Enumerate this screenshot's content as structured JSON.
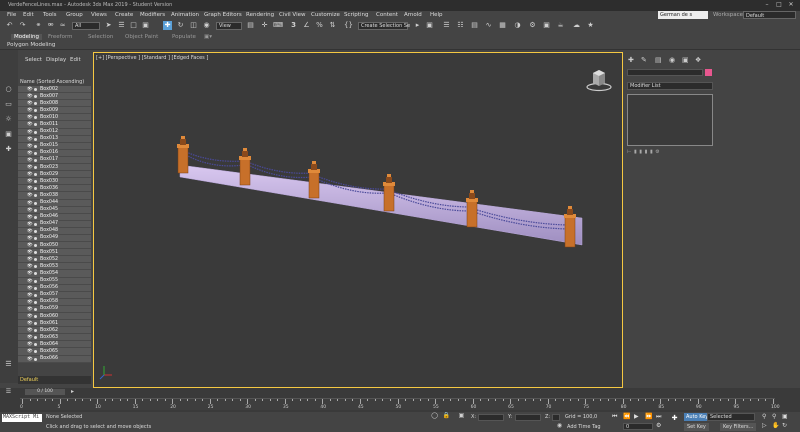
{
  "window": {
    "title": "VerdeFenceLines.max - Autodesk 3ds Max 2019 - Student Version",
    "user": "German de s",
    "workspace_label": "Workspaces:",
    "workspace_value": "Default"
  },
  "menu": [
    "File",
    "Edit",
    "Tools",
    "Group",
    "Views",
    "Create",
    "Modifiers",
    "Animation",
    "Graph Editors",
    "Rendering",
    "Civil View",
    "Customize",
    "Scripting",
    "Content",
    "Arnold",
    "Help"
  ],
  "toolbar": {
    "filter_value": "All",
    "view_value": "View",
    "selection_set": "Create Selection Se"
  },
  "ribbon": {
    "tabs": [
      "Modeling",
      "Freeform",
      "Selection",
      "Object Paint",
      "Populate"
    ],
    "active_tab": "Modeling",
    "sub": "Polygon Modeling"
  },
  "explorer": {
    "tabs": [
      "Select",
      "Display",
      "Edit"
    ],
    "header": "Name (Sorted Ascending)",
    "items": [
      "Box002",
      "Box007",
      "Box008",
      "Box009",
      "Box010",
      "Box011",
      "Box012",
      "Box013",
      "Box015",
      "Box016",
      "Box017",
      "Box023",
      "Box029",
      "Box030",
      "Box036",
      "Box038",
      "Box044",
      "Box045",
      "Box046",
      "Box047",
      "Box048",
      "Box049",
      "Box050",
      "Box051",
      "Box052",
      "Box053",
      "Box054",
      "Box055",
      "Box056",
      "Box057",
      "Box058",
      "Box059",
      "Box060",
      "Box061",
      "Box062",
      "Box063",
      "Box064",
      "Box065",
      "Box066"
    ],
    "layer": "Default"
  },
  "viewport": {
    "label": "[+] [Perspective ] [Standard ] [Edged Faces ]"
  },
  "command_panel": {
    "modifier_list": "Modifier List"
  },
  "timeline": {
    "slider": "0 / 100",
    "ticks": [
      "0",
      "5",
      "10",
      "15",
      "20",
      "25",
      "30",
      "35",
      "40",
      "45",
      "50",
      "55",
      "60",
      "65",
      "70",
      "75",
      "80",
      "85",
      "90",
      "95",
      "100"
    ]
  },
  "status": {
    "maxscript": "MAXScript Mi",
    "none_selected": "None Selected",
    "hint": "Click and drag to select and move objects",
    "x_label": "X:",
    "y_label": "Y:",
    "z_label": "Z:",
    "grid": "Grid = 100,0",
    "add_time_tag": "Add Time Tag",
    "auto_key": "Auto Key",
    "selected": "Selected",
    "set_key": "Set Key",
    "key_filters": "Key Filters...",
    "frame_value": "0"
  }
}
